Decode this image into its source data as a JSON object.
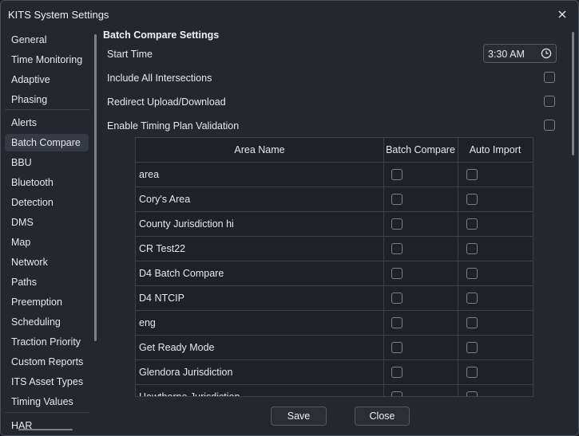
{
  "window": {
    "title": "KITS System Settings"
  },
  "sidebar": {
    "items": [
      {
        "label": "General"
      },
      {
        "label": "Time Monitoring"
      },
      {
        "label": "Adaptive"
      },
      {
        "label": "Phasing"
      },
      {
        "label": "Alerts"
      },
      {
        "label": "Batch Compare",
        "selected": true
      },
      {
        "label": "BBU"
      },
      {
        "label": "Bluetooth"
      },
      {
        "label": "Detection"
      },
      {
        "label": "DMS"
      },
      {
        "label": "Map"
      },
      {
        "label": "Network"
      },
      {
        "label": "Paths"
      },
      {
        "label": "Preemption"
      },
      {
        "label": "Scheduling"
      },
      {
        "label": "Traction Priority"
      },
      {
        "label": "Custom Reports"
      },
      {
        "label": "ITS Asset Types"
      },
      {
        "label": "Timing Values"
      },
      {
        "label": "HAR"
      }
    ]
  },
  "main": {
    "section_title": "Batch Compare Settings",
    "start_time_label": "Start Time",
    "start_time_value": "3:30 AM",
    "include_all_label": "Include All Intersections",
    "include_all_checked": false,
    "redirect_label": "Redirect Upload/Download",
    "redirect_checked": false,
    "validation_label": "Enable Timing Plan Validation",
    "validation_checked": false,
    "table": {
      "headers": {
        "area_name": "Area Name",
        "batch_compare": "Batch Compare",
        "auto_import": "Auto Import"
      },
      "rows": [
        {
          "name": "area",
          "batch": false,
          "auto": false
        },
        {
          "name": "Cory's Area",
          "batch": false,
          "auto": false
        },
        {
          "name": "County Jurisdiction hi",
          "batch": false,
          "auto": false
        },
        {
          "name": "CR Test22",
          "batch": false,
          "auto": false
        },
        {
          "name": "D4 Batch Compare",
          "batch": false,
          "auto": false
        },
        {
          "name": "D4 NTCIP",
          "batch": false,
          "auto": false
        },
        {
          "name": "eng",
          "batch": false,
          "auto": false
        },
        {
          "name": "Get Ready Mode",
          "batch": false,
          "auto": false
        },
        {
          "name": "Glendora Jurisdiction",
          "batch": false,
          "auto": false
        },
        {
          "name": "Hawthorne Jurisdiction",
          "batch": false,
          "auto": false
        }
      ]
    }
  },
  "footer": {
    "save_label": "Save",
    "close_label": "Close"
  },
  "colors": {
    "background": "#24272d",
    "selected": "#363a42",
    "border": "#3c4048"
  },
  "icons": {
    "close": "close-icon",
    "clock": "clock-icon"
  }
}
